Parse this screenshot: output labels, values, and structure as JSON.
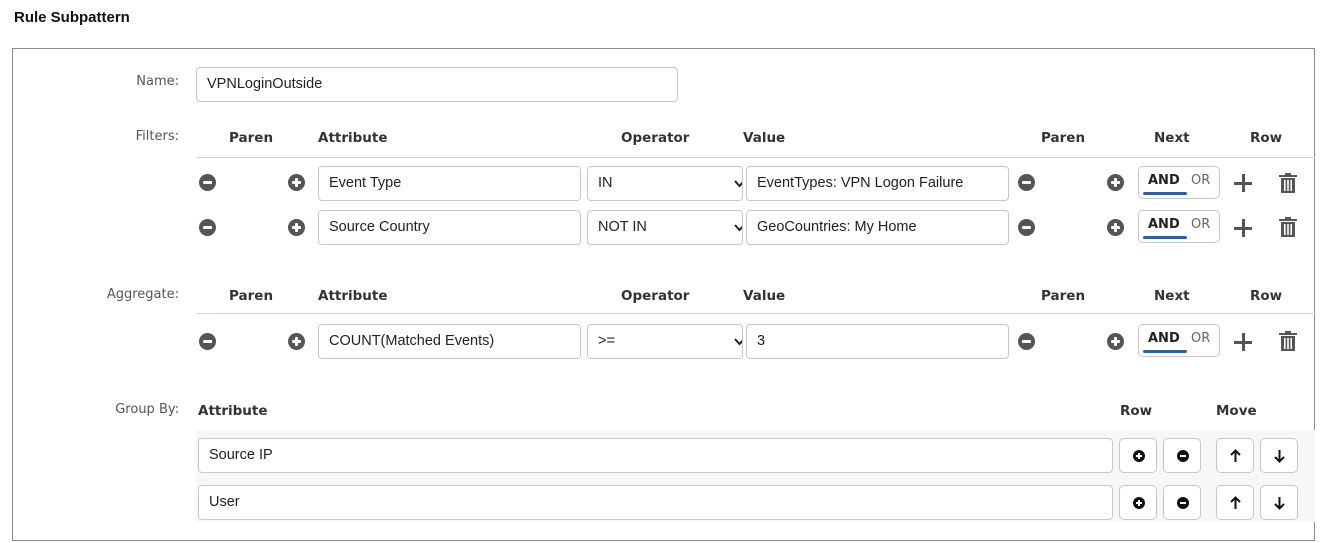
{
  "page": {
    "title": "Rule Subpattern"
  },
  "name": {
    "label": "Name:",
    "value": "VPNLoginOutside"
  },
  "filters": {
    "label": "Filters:",
    "headers": {
      "paren_open": "Paren",
      "attribute": "Attribute",
      "operator": "Operator",
      "value": "Value",
      "paren_close": "Paren",
      "next": "Next",
      "row": "Row"
    },
    "rows": [
      {
        "attribute": "Event Type",
        "operator": "IN",
        "value": "EventTypes: VPN Logon Failure",
        "next_and": "AND",
        "next_or": "OR"
      },
      {
        "attribute": "Source Country",
        "operator": "NOT IN",
        "value": "GeoCountries: My Home",
        "next_and": "AND",
        "next_or": "OR"
      }
    ]
  },
  "aggregate": {
    "label": "Aggregate:",
    "headers": {
      "paren_open": "Paren",
      "attribute": "Attribute",
      "operator": "Operator",
      "value": "Value",
      "paren_close": "Paren",
      "next": "Next",
      "row": "Row"
    },
    "rows": [
      {
        "attribute": "COUNT(Matched Events)",
        "operator": ">=",
        "value": "3",
        "next_and": "AND",
        "next_or": "OR"
      }
    ]
  },
  "group_by": {
    "label": "Group By:",
    "headers": {
      "attribute": "Attribute",
      "row": "Row",
      "move": "Move"
    },
    "rows": [
      {
        "attribute": "Source IP"
      },
      {
        "attribute": "User"
      }
    ]
  },
  "colors": {
    "accent": "#2f5f9e",
    "icon": "#555555",
    "border": "#c8c8c8"
  }
}
